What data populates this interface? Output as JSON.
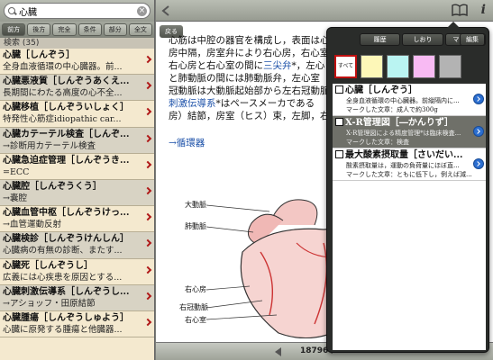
{
  "search": {
    "value": "心臓"
  },
  "modes": [
    "前方",
    "後方",
    "完全",
    "条件",
    "部分",
    "全文"
  ],
  "results_count": "検索 (35)",
  "results": [
    {
      "title": "心臓［しんぞう］",
      "sub": "全身血液循環の中心臓器。前..."
    },
    {
      "title": "心臓悪液質［しんぞうあくえ...",
      "sub": "長期間にわたる高度の心不全..."
    },
    {
      "title": "心臓移植［しんぞういしょく］",
      "sub": "特発性心筋症idiopathic car..."
    },
    {
      "title": "心臓カテーテル検査［しんぞ...",
      "sub": "→診断用カテーテル検査"
    },
    {
      "title": "心臓急迫症管理［しんぞうき...",
      "sub": "=ECC"
    },
    {
      "title": "心臓腔［しんぞうくう］",
      "sub": "→嚢腔"
    },
    {
      "title": "心臓血管中枢［しんぞうけっ...",
      "sub": "→血管運動反射"
    },
    {
      "title": "心臓検診［しんぞうけんしん］",
      "sub": "心臓病の有無の診断、またす..."
    },
    {
      "title": "心臓死［しんぞうし］",
      "sub": "広義には心疾患を原因とする..."
    },
    {
      "title": "心臓刺激伝導系［しんぞうし...",
      "sub": "→アショッフ・田原結節"
    },
    {
      "title": "心臓腫瘍［しんぞうしゅよう］",
      "sub": "心臓に原発する腫瘍と他臓器..."
    }
  ],
  "topbar": {
    "back_label": "戻る",
    "book_icon": "book-icon",
    "info_icon": "i"
  },
  "article": {
    "lines": [
      "心筋は中腔の器官を構成し，表面は心",
      "房中隔，房室弁により右心房，右心室",
      "右心房と右心室の間に",
      "と肺動脈の間には肺動脈弁，左心室",
      "冠動脈は大動脈起始部から左右冠動脈",
      "房）結節，房室（ヒス）束，左脚，右脚"
    ],
    "link_sanjiben": "三尖弁",
    "line3_tail": "*，左心",
    "link_shigeki": "刺激伝導系",
    "line6_mid": "*はペースメーカである",
    "see_also": "→循環器"
  },
  "diagram": {
    "labels": [
      "大動脈",
      "肺動脈",
      "右心房",
      "右冠動脈",
      "右心室"
    ]
  },
  "pager": {
    "text": "18796 / 56168"
  },
  "popover": {
    "tabs": [
      "履歴",
      "しおり",
      "マーカー"
    ],
    "edit_label": "編集",
    "swatch_all": "すべて",
    "swatches": [
      "#fdf7b8",
      "#baf4f2",
      "#f8baf3",
      "#b3b3b3"
    ],
    "items": [
      {
        "title": "心臓［しんぞう］",
        "sub1": "全身血液循環の中心臓器。前縦隔内に...",
        "sub2": "マークした文章：成人で約300g"
      },
      {
        "title": "X-R管理図［―かんりず］",
        "sub1": "X-R管理図による精度管理*は臨床検査...",
        "sub2": "マークした文章：検査"
      },
      {
        "title": "最大酸素摂取量［さいだい...",
        "sub1": "酸素摂取量は，運動の負荷量にほぼ直...",
        "sub2": "マークした文章：ともに低下し，例えば減..."
      }
    ]
  }
}
